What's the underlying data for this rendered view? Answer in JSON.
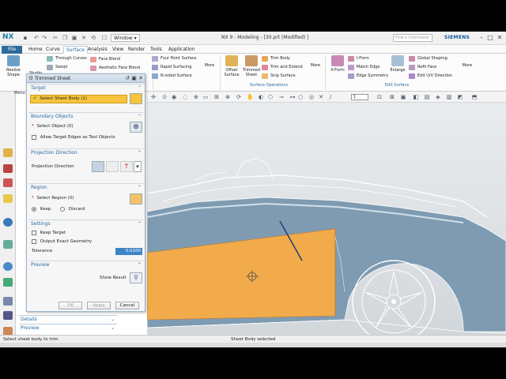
{
  "titlebar": {
    "logo": "NX",
    "window_button": "Window ▾",
    "title": "NX 9 - Modeling - [30.prt (Modified) ]",
    "search_placeholder": "Find a Command",
    "brand": "SIEMENS"
  },
  "menu": [
    "File",
    "Home",
    "Curve",
    "Surface",
    "Analysis",
    "View",
    "Render",
    "Tools",
    "Application"
  ],
  "active_menu": "Surface",
  "ribbon": {
    "realize_shape": "Realize Shape",
    "studio": "Studio",
    "col1": [
      "Through Curves",
      "Swept"
    ],
    "col2": [
      "Face Blend",
      "Aesthetic Face Blend"
    ],
    "col3": [
      "Four Point Surface",
      "Rapid Surfacing",
      "N-sided Surface"
    ],
    "more1": "More",
    "offset_surface": "Offset Surface",
    "trimmed_sheet": "Trimmed Sheet",
    "col4": [
      "Trim Body",
      "Trim and Extend",
      "Snip Surface"
    ],
    "more2": "More",
    "surface_operations": "Surface Operations",
    "xform": "X-Form",
    "col5": [
      "I-Form",
      "Match Edge",
      "Edge Symmetry"
    ],
    "enlarge": "Enlarge",
    "col6": [
      "Global Shaping",
      "Refit Face",
      "Edit U/V Direction"
    ],
    "more3": "More",
    "edit_surface": "Edit Surface",
    "filter_value": "1"
  },
  "nav": {
    "menu_label": "Menu",
    "details": "Details",
    "preview": "Preview"
  },
  "dialog": {
    "title": "Trimmed Sheet",
    "target": {
      "header": "Target",
      "select_sheet": "Select Sheet Body (1)"
    },
    "boundary": {
      "header": "Boundary Objects",
      "select_object": "Select Object (0)",
      "allow_target_edges": "Allow Target Edges as Tool Objects"
    },
    "projection": {
      "header": "Projection Direction",
      "label": "Projection Direction"
    },
    "region": {
      "header": "Region",
      "select_region": "Select Region (0)",
      "keep": "Keep",
      "discard": "Discard"
    },
    "settings": {
      "header": "Settings",
      "keep_target": "Keep Target",
      "output_exact": "Output Exact Geometry",
      "tolerance_label": "Tolerance",
      "tolerance_value": "0.0100"
    },
    "preview": {
      "header": "Preview",
      "show_result": "Show Result"
    },
    "buttons": {
      "ok": "OK",
      "apply": "Apply",
      "cancel": "Cancel"
    }
  },
  "status": {
    "left": "Select sheet body to trim",
    "center": "Sheet Body selected"
  },
  "colors": {
    "accent": "#2a6aa3",
    "highlight": "#f7c43c",
    "car_body": "#7e9bb1",
    "selected_face": "#f2ab4b"
  }
}
